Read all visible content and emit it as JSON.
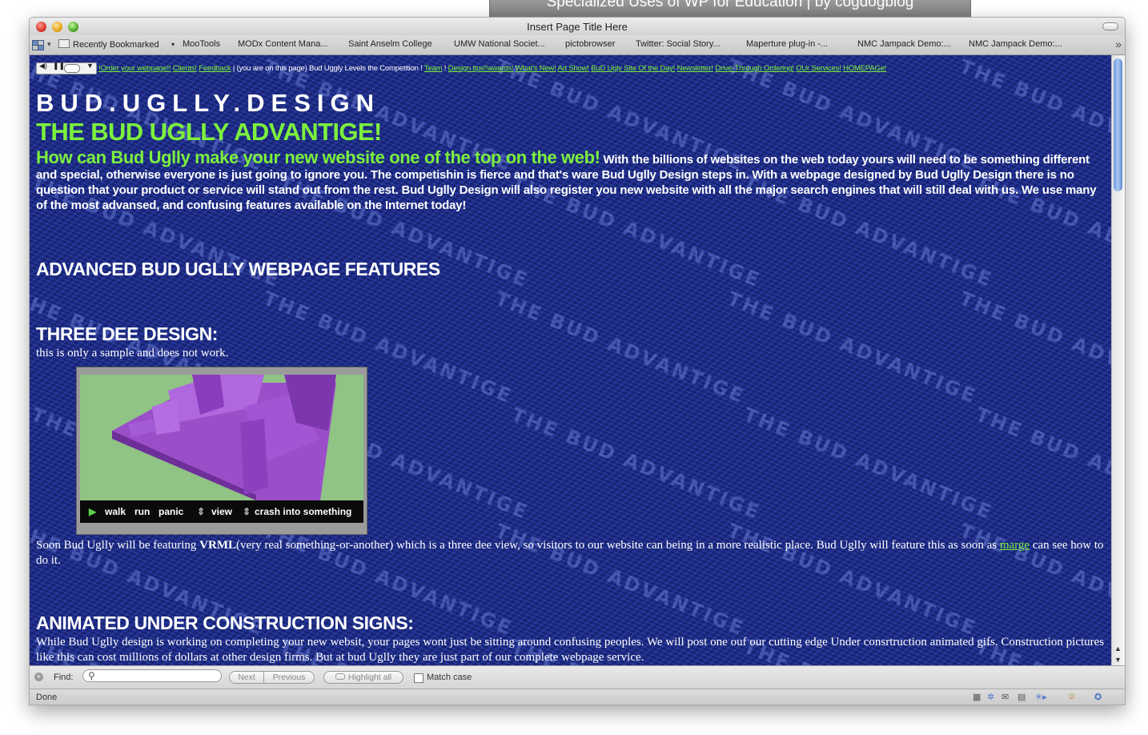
{
  "background_window": {
    "title": "Specialized Uses of WP for Education | by cogdogblog"
  },
  "window": {
    "title": "Insert Page Title Here"
  },
  "bookmarks": {
    "items": [
      "Recently Bookmarked",
      "MooTools",
      "MODx Content Mana...",
      "Saint Anselm College",
      "UMW National Societ...",
      "pictobrowser",
      "Twitter: Social Story...",
      "Maperture plug-in -...",
      "NMC Jampack Demo:...",
      "NMC Jampack Demo:..."
    ],
    "overflow": "»"
  },
  "page": {
    "watermark": "THE BUD ADVANTIGE",
    "nav": {
      "links": [
        "!Order your webpage!!",
        "Clients!",
        "Feedback",
        "Team",
        "Design tips!!",
        "awards!",
        "What's New!",
        "Art Show!",
        "BuD Ugly Site Of the Day!",
        "Newsletter!",
        "Drive-Through Ordering!",
        "OUr Services!",
        "HOMEPAGe!"
      ],
      "current_text": " | (you are on this page) Bud Uggly Levels the Competition ! "
    },
    "site_title": "BUD.UGLLY.DESIGN",
    "site_subtitle": "THE BUD UGLLY ADVANTIGE!",
    "intro_lead": "How can Bud Uglly make your new website one of the top on the web!",
    "intro_body": " With the billions of websites on the web today yours will need to be something different and special, otherwise everyone is just going to ignore you. The competishin is fierce and that's ware Bud Uglly Design steps in. With a webpage designed by Bud Uglly Design there is no question that your product or service will stand out from the rest. Bud Uglly Design will also register you new website with all the major search engines that will still deal with us. We use many of the most advansed, and confusing features available on the Internet today!",
    "section_features": "ADVANCED BUD UGLLY WEBPAGE FEATURES",
    "section_3d": "THREE DEE DESIGN:",
    "sample_note": "this is only a sample and does not work.",
    "vrml_controls": [
      "walk",
      "run",
      "panic",
      "view",
      "crash into something"
    ],
    "vrml_text_1": "Soon Bud Uglly will be featuring ",
    "vrml_text_bold": "VRML",
    "vrml_text_2": "(very real something-or-another) which is a three dee view, so visitors to our website can being in a more realistic place. Bud Uglly will feature this as soon as ",
    "vrml_link": "marge",
    "vrml_text_3": " can see how to do it.",
    "section_anim": "ANIMATED UNDER CONSTRUCTION SIGNS:",
    "anim_text": "While Bud Uglly design is working on completing your new websit, your pages wont just be sitting around confusing peoples. We will post one ouf our cutting edge Under consrtruction animated gifs. Construction pictures like this can cost millions of dollars at other design firms. But at bud Uglly they are just part of our complete webpage service."
  },
  "findbar": {
    "label": "Find:",
    "value": "",
    "next": "Next",
    "previous": "Previous",
    "highlight": "Highlight all",
    "match_case": "Match case"
  },
  "status": {
    "text": "Done"
  },
  "colors": {
    "page_bg": "#1a2a8a",
    "accent_green": "#7cf03d",
    "text": "#ffffff",
    "vrml_bg": "#8fc485",
    "vrml_purple": "#9a4fc9"
  }
}
